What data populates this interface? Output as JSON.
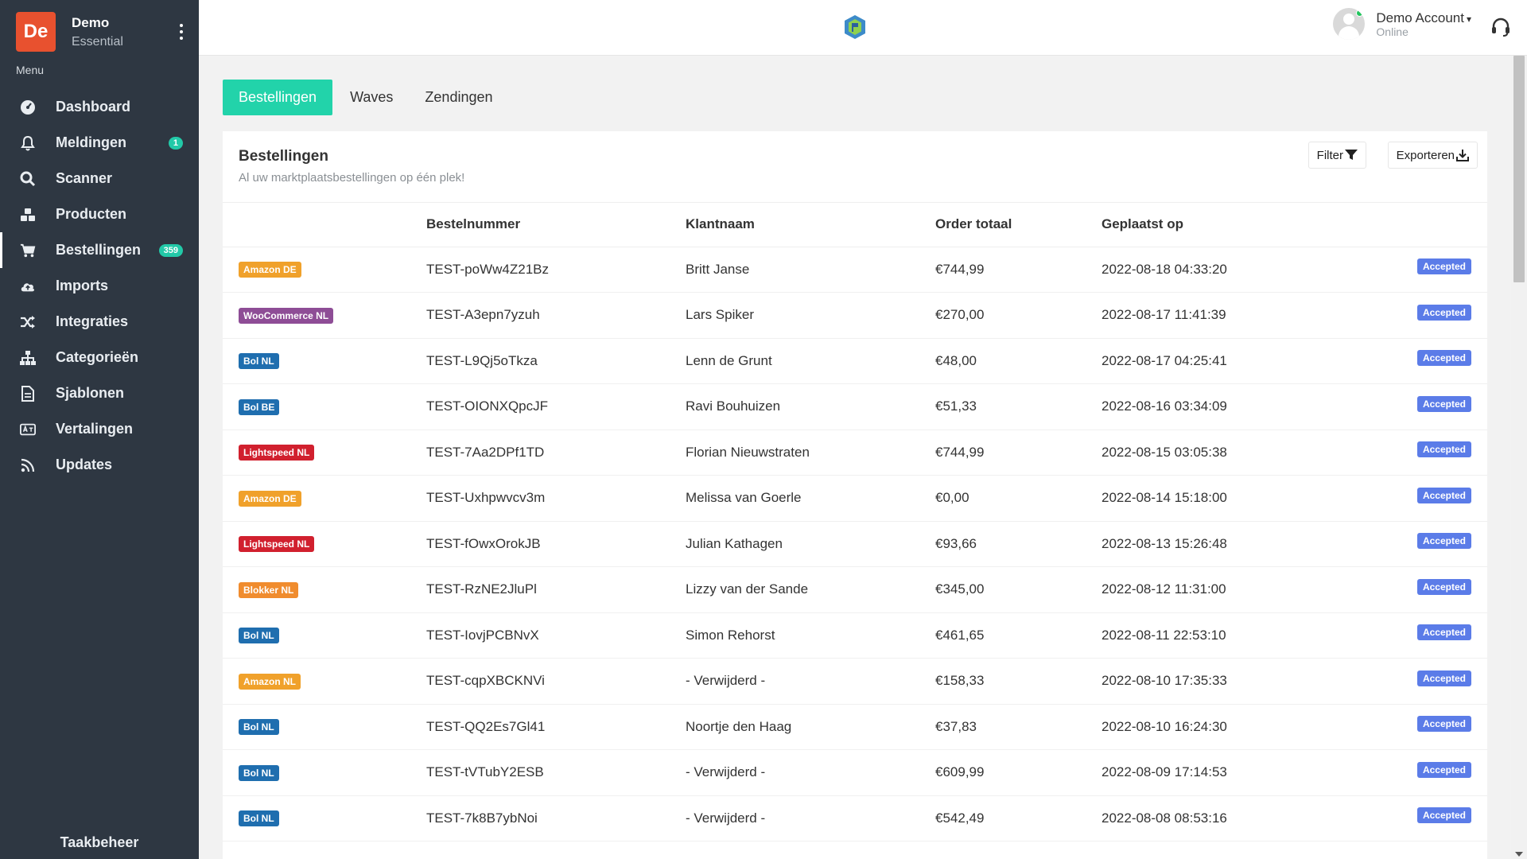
{
  "brand": {
    "initials": "De",
    "name": "Demo",
    "plan": "Essential",
    "color": "#e8512f"
  },
  "sidebar": {
    "menu_label": "Menu",
    "items": [
      {
        "label": "Dashboard",
        "icon": "dashboard-icon"
      },
      {
        "label": "Meldingen",
        "icon": "bell-icon",
        "badge": "1"
      },
      {
        "label": "Scanner",
        "icon": "search-icon"
      },
      {
        "label": "Producten",
        "icon": "boxes-icon"
      },
      {
        "label": "Bestellingen",
        "icon": "cart-icon",
        "badge": "359",
        "active": true
      },
      {
        "label": "Imports",
        "icon": "cloud-upload-icon"
      },
      {
        "label": "Integraties",
        "icon": "shuffle-icon"
      },
      {
        "label": "Categorieën",
        "icon": "sitemap-icon"
      },
      {
        "label": "Sjablonen",
        "icon": "file-icon"
      },
      {
        "label": "Vertalingen",
        "icon": "language-icon"
      },
      {
        "label": "Updates",
        "icon": "rss-icon"
      }
    ],
    "footer": "Taakbeheer"
  },
  "topbar": {
    "account_name": "Demo Account",
    "account_status": "Online"
  },
  "tabs": [
    {
      "label": "Bestellingen",
      "active": true
    },
    {
      "label": "Waves"
    },
    {
      "label": "Zendingen"
    }
  ],
  "card": {
    "title": "Bestellingen",
    "subtitle": "Al uw marktplaatsbestellingen op één plek!",
    "filter_label": "Filter",
    "export_label": "Exporteren"
  },
  "table": {
    "columns": [
      "",
      "Bestelnummer",
      "Klantnaam",
      "Order totaal",
      "Geplaatst op",
      ""
    ],
    "rows": [
      {
        "source": "Amazon DE",
        "source_color": "#f0a12b",
        "order": "TEST-poWw4Z21Bz",
        "customer": "Britt Janse",
        "total": "€744,99",
        "date": "2022-08-18 04:33:20",
        "status": "Accepted"
      },
      {
        "source": "WooCommerce NL",
        "source_color": "#8e4d96",
        "order": "TEST-A3epn7yzuh",
        "customer": "Lars Spiker",
        "total": "€270,00",
        "date": "2022-08-17 11:41:39",
        "status": "Accepted"
      },
      {
        "source": "Bol NL",
        "source_color": "#1f6eaf",
        "order": "TEST-L9Qj5oTkza",
        "customer": "Lenn de Grunt",
        "total": "€48,00",
        "date": "2022-08-17 04:25:41",
        "status": "Accepted"
      },
      {
        "source": "Bol BE",
        "source_color": "#1f6eaf",
        "order": "TEST-OIONXQpcJF",
        "customer": "Ravi Bouhuizen",
        "total": "€51,33",
        "date": "2022-08-16 03:34:09",
        "status": "Accepted"
      },
      {
        "source": "Lightspeed NL",
        "source_color": "#d1202e",
        "order": "TEST-7Aa2DPf1TD",
        "customer": "Florian Nieuwstraten",
        "total": "€744,99",
        "date": "2022-08-15 03:05:38",
        "status": "Accepted"
      },
      {
        "source": "Amazon DE",
        "source_color": "#f0a12b",
        "order": "TEST-Uxhpwvcv3m",
        "customer": "Melissa van Goerle",
        "total": "€0,00",
        "date": "2022-08-14 15:18:00",
        "status": "Accepted"
      },
      {
        "source": "Lightspeed NL",
        "source_color": "#d1202e",
        "order": "TEST-fOwxOrokJB",
        "customer": "Julian Kathagen",
        "total": "€93,66",
        "date": "2022-08-13 15:26:48",
        "status": "Accepted"
      },
      {
        "source": "Blokker NL",
        "source_color": "#f08c2e",
        "order": "TEST-RzNE2JluPl",
        "customer": "Lizzy van der Sande",
        "total": "€345,00",
        "date": "2022-08-12 11:31:00",
        "status": "Accepted"
      },
      {
        "source": "Bol NL",
        "source_color": "#1f6eaf",
        "order": "TEST-IovjPCBNvX",
        "customer": "Simon Rehorst",
        "total": "€461,65",
        "date": "2022-08-11 22:53:10",
        "status": "Accepted"
      },
      {
        "source": "Amazon NL",
        "source_color": "#f0a12b",
        "order": "TEST-cqpXBCKNVi",
        "customer": "- Verwijderd -",
        "total": "€158,33",
        "date": "2022-08-10 17:35:33",
        "status": "Accepted"
      },
      {
        "source": "Bol NL",
        "source_color": "#1f6eaf",
        "order": "TEST-QQ2Es7Gl41",
        "customer": "Noortje den Haag",
        "total": "€37,83",
        "date": "2022-08-10 16:24:30",
        "status": "Accepted"
      },
      {
        "source": "Bol NL",
        "source_color": "#1f6eaf",
        "order": "TEST-tVTubY2ESB",
        "customer": "- Verwijderd -",
        "total": "€609,99",
        "date": "2022-08-09 17:14:53",
        "status": "Accepted"
      },
      {
        "source": "Bol NL",
        "source_color": "#1f6eaf",
        "order": "TEST-7k8B7ybNoi",
        "customer": "- Verwijderd -",
        "total": "€542,49",
        "date": "2022-08-08 08:53:16",
        "status": "Accepted"
      }
    ]
  },
  "colors": {
    "accent": "#22d3aa",
    "sidebar_bg": "#2e3742",
    "status_badge": "#5b7ce8"
  }
}
